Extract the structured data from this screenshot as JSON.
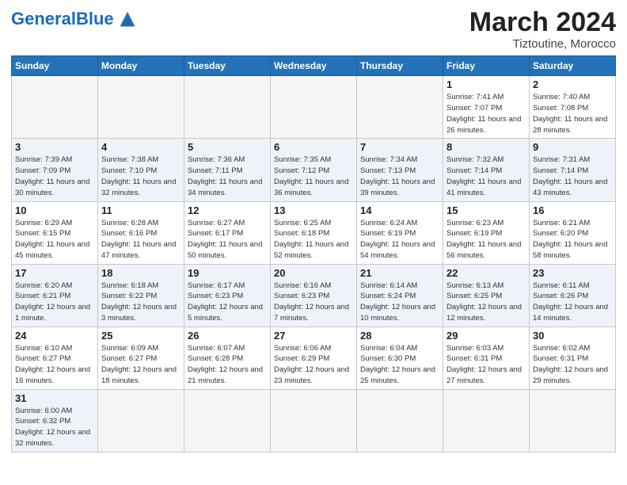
{
  "header": {
    "logo_general": "General",
    "logo_blue": "Blue",
    "month_title": "March 2024",
    "subtitle": "Tiztoutine, Morocco"
  },
  "days_of_week": [
    "Sunday",
    "Monday",
    "Tuesday",
    "Wednesday",
    "Thursday",
    "Friday",
    "Saturday"
  ],
  "weeks": [
    [
      {
        "day": "",
        "info": ""
      },
      {
        "day": "",
        "info": ""
      },
      {
        "day": "",
        "info": ""
      },
      {
        "day": "",
        "info": ""
      },
      {
        "day": "",
        "info": ""
      },
      {
        "day": "1",
        "info": "Sunrise: 7:41 AM\nSunset: 7:07 PM\nDaylight: 11 hours and 26 minutes."
      },
      {
        "day": "2",
        "info": "Sunrise: 7:40 AM\nSunset: 7:08 PM\nDaylight: 11 hours and 28 minutes."
      }
    ],
    [
      {
        "day": "3",
        "info": "Sunrise: 7:39 AM\nSunset: 7:09 PM\nDaylight: 11 hours and 30 minutes."
      },
      {
        "day": "4",
        "info": "Sunrise: 7:38 AM\nSunset: 7:10 PM\nDaylight: 11 hours and 32 minutes."
      },
      {
        "day": "5",
        "info": "Sunrise: 7:36 AM\nSunset: 7:11 PM\nDaylight: 11 hours and 34 minutes."
      },
      {
        "day": "6",
        "info": "Sunrise: 7:35 AM\nSunset: 7:12 PM\nDaylight: 11 hours and 36 minutes."
      },
      {
        "day": "7",
        "info": "Sunrise: 7:34 AM\nSunset: 7:13 PM\nDaylight: 11 hours and 39 minutes."
      },
      {
        "day": "8",
        "info": "Sunrise: 7:32 AM\nSunset: 7:14 PM\nDaylight: 11 hours and 41 minutes."
      },
      {
        "day": "9",
        "info": "Sunrise: 7:31 AM\nSunset: 7:14 PM\nDaylight: 11 hours and 43 minutes."
      }
    ],
    [
      {
        "day": "10",
        "info": "Sunrise: 6:29 AM\nSunset: 6:15 PM\nDaylight: 11 hours and 45 minutes."
      },
      {
        "day": "11",
        "info": "Sunrise: 6:28 AM\nSunset: 6:16 PM\nDaylight: 11 hours and 47 minutes."
      },
      {
        "day": "12",
        "info": "Sunrise: 6:27 AM\nSunset: 6:17 PM\nDaylight: 11 hours and 50 minutes."
      },
      {
        "day": "13",
        "info": "Sunrise: 6:25 AM\nSunset: 6:18 PM\nDaylight: 11 hours and 52 minutes."
      },
      {
        "day": "14",
        "info": "Sunrise: 6:24 AM\nSunset: 6:19 PM\nDaylight: 11 hours and 54 minutes."
      },
      {
        "day": "15",
        "info": "Sunrise: 6:23 AM\nSunset: 6:19 PM\nDaylight: 11 hours and 56 minutes."
      },
      {
        "day": "16",
        "info": "Sunrise: 6:21 AM\nSunset: 6:20 PM\nDaylight: 11 hours and 58 minutes."
      }
    ],
    [
      {
        "day": "17",
        "info": "Sunrise: 6:20 AM\nSunset: 6:21 PM\nDaylight: 12 hours and 1 minute."
      },
      {
        "day": "18",
        "info": "Sunrise: 6:18 AM\nSunset: 6:22 PM\nDaylight: 12 hours and 3 minutes."
      },
      {
        "day": "19",
        "info": "Sunrise: 6:17 AM\nSunset: 6:23 PM\nDaylight: 12 hours and 5 minutes."
      },
      {
        "day": "20",
        "info": "Sunrise: 6:16 AM\nSunset: 6:23 PM\nDaylight: 12 hours and 7 minutes."
      },
      {
        "day": "21",
        "info": "Sunrise: 6:14 AM\nSunset: 6:24 PM\nDaylight: 12 hours and 10 minutes."
      },
      {
        "day": "22",
        "info": "Sunrise: 6:13 AM\nSunset: 6:25 PM\nDaylight: 12 hours and 12 minutes."
      },
      {
        "day": "23",
        "info": "Sunrise: 6:11 AM\nSunset: 6:26 PM\nDaylight: 12 hours and 14 minutes."
      }
    ],
    [
      {
        "day": "24",
        "info": "Sunrise: 6:10 AM\nSunset: 6:27 PM\nDaylight: 12 hours and 16 minutes."
      },
      {
        "day": "25",
        "info": "Sunrise: 6:09 AM\nSunset: 6:27 PM\nDaylight: 12 hours and 18 minutes."
      },
      {
        "day": "26",
        "info": "Sunrise: 6:07 AM\nSunset: 6:28 PM\nDaylight: 12 hours and 21 minutes."
      },
      {
        "day": "27",
        "info": "Sunrise: 6:06 AM\nSunset: 6:29 PM\nDaylight: 12 hours and 23 minutes."
      },
      {
        "day": "28",
        "info": "Sunrise: 6:04 AM\nSunset: 6:30 PM\nDaylight: 12 hours and 25 minutes."
      },
      {
        "day": "29",
        "info": "Sunrise: 6:03 AM\nSunset: 6:31 PM\nDaylight: 12 hours and 27 minutes."
      },
      {
        "day": "30",
        "info": "Sunrise: 6:02 AM\nSunset: 6:31 PM\nDaylight: 12 hours and 29 minutes."
      }
    ],
    [
      {
        "day": "31",
        "info": "Sunrise: 6:00 AM\nSunset: 6:32 PM\nDaylight: 12 hours and 32 minutes."
      },
      {
        "day": "",
        "info": ""
      },
      {
        "day": "",
        "info": ""
      },
      {
        "day": "",
        "info": ""
      },
      {
        "day": "",
        "info": ""
      },
      {
        "day": "",
        "info": ""
      },
      {
        "day": "",
        "info": ""
      }
    ]
  ]
}
